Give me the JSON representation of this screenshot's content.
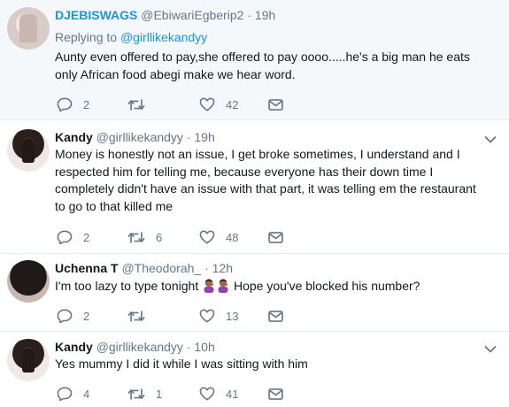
{
  "tweets": [
    {
      "name": "DJEBISWAGS",
      "handle": "@EbiwariEgberip2",
      "dot": "·",
      "time": "19h",
      "replying_prefix": "Replying to",
      "replying_to": "@girllikekandyy",
      "text": "Aunty even offered to pay,she offered to pay oooo.....he's a big man he eats only African food abegi make we hear word.",
      "replies": "2",
      "retweets": "",
      "likes": "42"
    },
    {
      "name": "Kandy",
      "handle": "@girllikekandyy",
      "dot": "·",
      "time": "19h",
      "text": "Money is honestly not an issue, I get broke sometimes, I understand and I respected him for telling me, because everyone has their down time I completely didn't have an issue with that part, it was telling em the restaurant to go to that killed me",
      "replies": "2",
      "retweets": "6",
      "likes": "48"
    },
    {
      "name": "Uchenna T",
      "handle": "@Theodorah_",
      "dot": "·",
      "time": "12h",
      "text_before": "I'm too lazy to type tonight",
      "text_after": "Hope you've blocked his number?",
      "emoji": "woman-facepalming-emoji",
      "replies": "2",
      "retweets": "",
      "likes": "13"
    },
    {
      "name": "Kandy",
      "handle": "@girllikekandyy",
      "dot": "·",
      "time": "10h",
      "text": "Yes mummy I did it while I was sitting with him",
      "replies": "4",
      "retweets": "1",
      "likes": "41"
    }
  ],
  "icons": {
    "reply": "reply-icon",
    "retweet": "retweet-icon",
    "like": "heart-icon",
    "dm": "envelope-icon",
    "caret": "chevron-down-icon"
  },
  "colors": {
    "link": "#1b95e0",
    "muted": "#657786",
    "text": "#14171a",
    "highlight_bg": "#f5f8fa"
  }
}
